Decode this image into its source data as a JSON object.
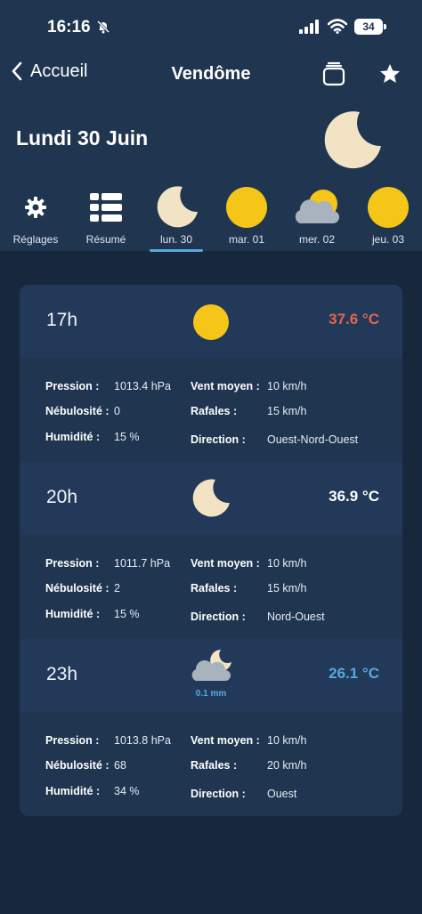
{
  "status_bar": {
    "time": "16:16",
    "battery": "34"
  },
  "nav": {
    "back_label": "Accueil",
    "title": "Vendôme"
  },
  "date": "Lundi 30 Juin",
  "tabs": [
    {
      "label": "Réglages",
      "icon": "gear-icon"
    },
    {
      "label": "Résumé",
      "icon": "grid-icon"
    },
    {
      "label": "lun. 30",
      "icon": "moon-icon",
      "active": true
    },
    {
      "label": "mar. 01",
      "icon": "sun-icon"
    },
    {
      "label": "mer. 02",
      "icon": "partly-cloudy-icon"
    },
    {
      "label": "jeu. 03",
      "icon": "sun-icon"
    }
  ],
  "labels": {
    "pressure": "Pression :",
    "cloud": "Nébulosité :",
    "humidity": "Humidité :",
    "wind": "Vent moyen :",
    "gusts": "Rafales :",
    "direction": "Direction :"
  },
  "forecasts": [
    {
      "hour": "17h",
      "icon": "sun-icon",
      "temp": "37.6 °C",
      "temp_color": "#e0674a",
      "pressure": "1013.4 hPa",
      "cloud": "0",
      "humidity": "15 %",
      "wind": "10 km/h",
      "gusts": "15 km/h",
      "direction": "Ouest-Nord-Ouest"
    },
    {
      "hour": "20h",
      "icon": "moon-icon",
      "temp": "36.9 °C",
      "temp_color": "#ffffff",
      "pressure": "1011.7 hPa",
      "cloud": "2",
      "humidity": "15 %",
      "wind": "10 km/h",
      "gusts": "15 km/h",
      "direction": "Nord-Ouest"
    },
    {
      "hour": "23h",
      "icon": "cloudy-moon-icon",
      "temp": "26.1 °C",
      "temp_color": "#55a9e0",
      "precip": "0.1 mm",
      "pressure": "1013.8 hPa",
      "cloud": "68",
      "humidity": "34 %",
      "wind": "10 km/h",
      "gusts": "20 km/h",
      "direction": "Ouest"
    }
  ]
}
